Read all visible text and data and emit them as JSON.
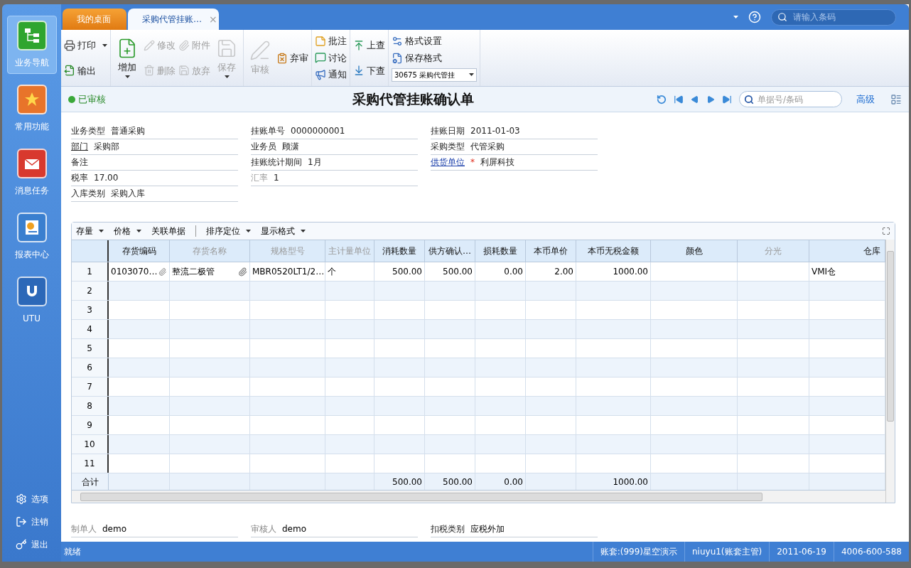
{
  "sidebar": {
    "items": [
      {
        "label": "业务导航",
        "selected": true
      },
      {
        "label": "常用功能",
        "selected": false
      },
      {
        "label": "消息任务",
        "selected": false
      },
      {
        "label": "报表中心",
        "selected": false
      },
      {
        "label": "UTU",
        "selected": false
      }
    ],
    "bottom_items": [
      "选项",
      "注销",
      "退出"
    ]
  },
  "tabs": [
    {
      "label": "我的桌面",
      "selected": false
    },
    {
      "label": "采购代管挂账…",
      "selected": true,
      "close": "×"
    }
  ],
  "top_search": {
    "placeholder": "请输入条码"
  },
  "toolbar": [
    [
      [
        {
          "label": "打印",
          "kind": "small",
          "disabled": false,
          "dropdown": true
        },
        {
          "label": "输出",
          "kind": "small",
          "disabled": false
        }
      ]
    ],
    [
      [
        {
          "label": "增加",
          "kind": "large",
          "disabled": false,
          "dropdown": true
        }
      ],
      [
        {
          "label": "修改",
          "kind": "small",
          "disabled": true
        },
        {
          "label": "删除",
          "kind": "small",
          "disabled": true
        }
      ],
      [
        {
          "label": "附件",
          "kind": "small",
          "disabled": true
        },
        {
          "label": "放弃",
          "kind": "small",
          "disabled": true
        }
      ],
      [
        {
          "label": "保存",
          "kind": "large",
          "disabled": true,
          "dropdown": true
        }
      ]
    ],
    [
      [
        {
          "label": "审核",
          "kind": "large",
          "disabled": true
        }
      ],
      [
        {
          "label": "弃审",
          "kind": "small",
          "disabled": false
        }
      ]
    ],
    [
      [
        {
          "label": "批注",
          "kind": "small",
          "disabled": false
        },
        {
          "label": "讨论",
          "kind": "small",
          "disabled": false
        },
        {
          "label": "通知",
          "kind": "small",
          "disabled": false
        }
      ]
    ],
    [
      [
        {
          "label": "上查",
          "kind": "small",
          "disabled": false
        },
        {
          "label": "下查",
          "kind": "small",
          "disabled": false
        }
      ]
    ],
    [
      [
        {
          "label": "格式设置",
          "kind": "small",
          "disabled": false
        },
        {
          "label": "保存格式",
          "kind": "small",
          "disabled": false
        },
        {
          "label": "30675 采购代管挂",
          "kind": "select"
        }
      ]
    ]
  ],
  "document": {
    "status": "已审核",
    "title": "采购代管挂账确认单",
    "search_placeholder": "单据号/条码",
    "advanced": "高级"
  },
  "header_fields": [
    [
      {
        "label": "业务类型",
        "value": "普通采购",
        "kind": "plain",
        "disabled": false
      },
      {
        "label": "部门",
        "value": "采购部",
        "kind": "reference",
        "disabled": false
      },
      {
        "label": "备注",
        "kind": "plain",
        "disabled": false
      },
      {
        "label": "税率",
        "value": "17.00",
        "kind": "plain",
        "disabled": false
      },
      {
        "label": "入库类别",
        "value": "采购入库",
        "kind": "plain",
        "disabled": false
      }
    ],
    [
      {
        "label": "挂账单号",
        "value": "0000000001",
        "kind": "plain",
        "disabled": false
      },
      {
        "label": "业务员",
        "value": "顾潇",
        "kind": "plain",
        "disabled": false
      },
      {
        "label": "挂账统计期间",
        "value": "1月",
        "kind": "plain",
        "disabled": false
      },
      {
        "label": "汇率",
        "value": "1",
        "kind": "plain",
        "disabled": true
      }
    ],
    [
      {
        "label": "挂账日期",
        "value": "2011-01-03",
        "kind": "plain",
        "disabled": false
      },
      {
        "label": "采购类型",
        "value": "代管采购",
        "kind": "plain",
        "disabled": false
      },
      {
        "label": "供货单位",
        "value": "利屏科技",
        "kind": "link",
        "disabled": false,
        "marker": "*"
      }
    ]
  ],
  "grid": {
    "menus": [
      {
        "label": "存量",
        "dropdown": true
      },
      {
        "label": "价格",
        "dropdown": true
      },
      {
        "label": "关联单据"
      },
      {
        "label": "排序定位",
        "dropdown": true
      },
      {
        "label": "显示格式",
        "dropdown": true
      }
    ],
    "columns": [
      {
        "label": "存货编码",
        "disabled": false
      },
      {
        "label": "存货名称",
        "disabled": true
      },
      {
        "label": "规格型号",
        "disabled": true
      },
      {
        "label": "主计量单位",
        "disabled": true
      },
      {
        "label": "消耗数量",
        "disabled": false
      },
      {
        "label": "供方确认…",
        "disabled": false
      },
      {
        "label": "损耗数量",
        "disabled": false
      },
      {
        "label": "本币单价",
        "disabled": false
      },
      {
        "label": "本币无税金额",
        "disabled": false
      },
      {
        "label": "颜色",
        "disabled": false
      },
      {
        "label": "分光",
        "disabled": true
      },
      {
        "label": "仓库",
        "disabled": false
      }
    ],
    "rows": [
      {
        "number": "1",
        "cells": [
          {
            "text": "0103070…",
            "attachment": true
          },
          {
            "text": "整流二极管",
            "attachment": true
          },
          {
            "text": "MBR0520LT1/2…"
          },
          {
            "text": "个"
          },
          {
            "text": "500.00"
          },
          {
            "text": "500.00"
          },
          {
            "text": "0.00"
          },
          {
            "text": "2.00"
          },
          {
            "text": "1000.00"
          },
          {},
          {},
          {
            "text": "VMI仓"
          }
        ]
      },
      {
        "number": "2"
      },
      {
        "number": "3"
      },
      {
        "number": "4"
      },
      {
        "number": "5"
      },
      {
        "number": "6"
      },
      {
        "number": "7"
      },
      {
        "number": "8"
      },
      {
        "number": "9"
      },
      {
        "number": "10"
      },
      {
        "number": "11"
      }
    ],
    "total": {
      "label": "合计",
      "cells": [
        {},
        {},
        {},
        {},
        {
          "text": "500.00"
        },
        {
          "text": "500.00"
        },
        {
          "text": "0.00"
        },
        {},
        {
          "text": "1000.00"
        },
        {},
        {},
        {}
      ]
    }
  },
  "footer_fields": [
    {
      "label": "制单人",
      "value": "demo",
      "disabled": true
    },
    {
      "label": "审核人",
      "value": "demo",
      "disabled": true
    },
    {
      "label": "扣税类别",
      "value": "应税外加",
      "disabled": false
    }
  ],
  "status_bar": {
    "message": "就绪",
    "items": [
      "账套:(999)星空演示",
      "niuyu1(账套主管)",
      "2011-06-19",
      "4006-600-588"
    ]
  }
}
